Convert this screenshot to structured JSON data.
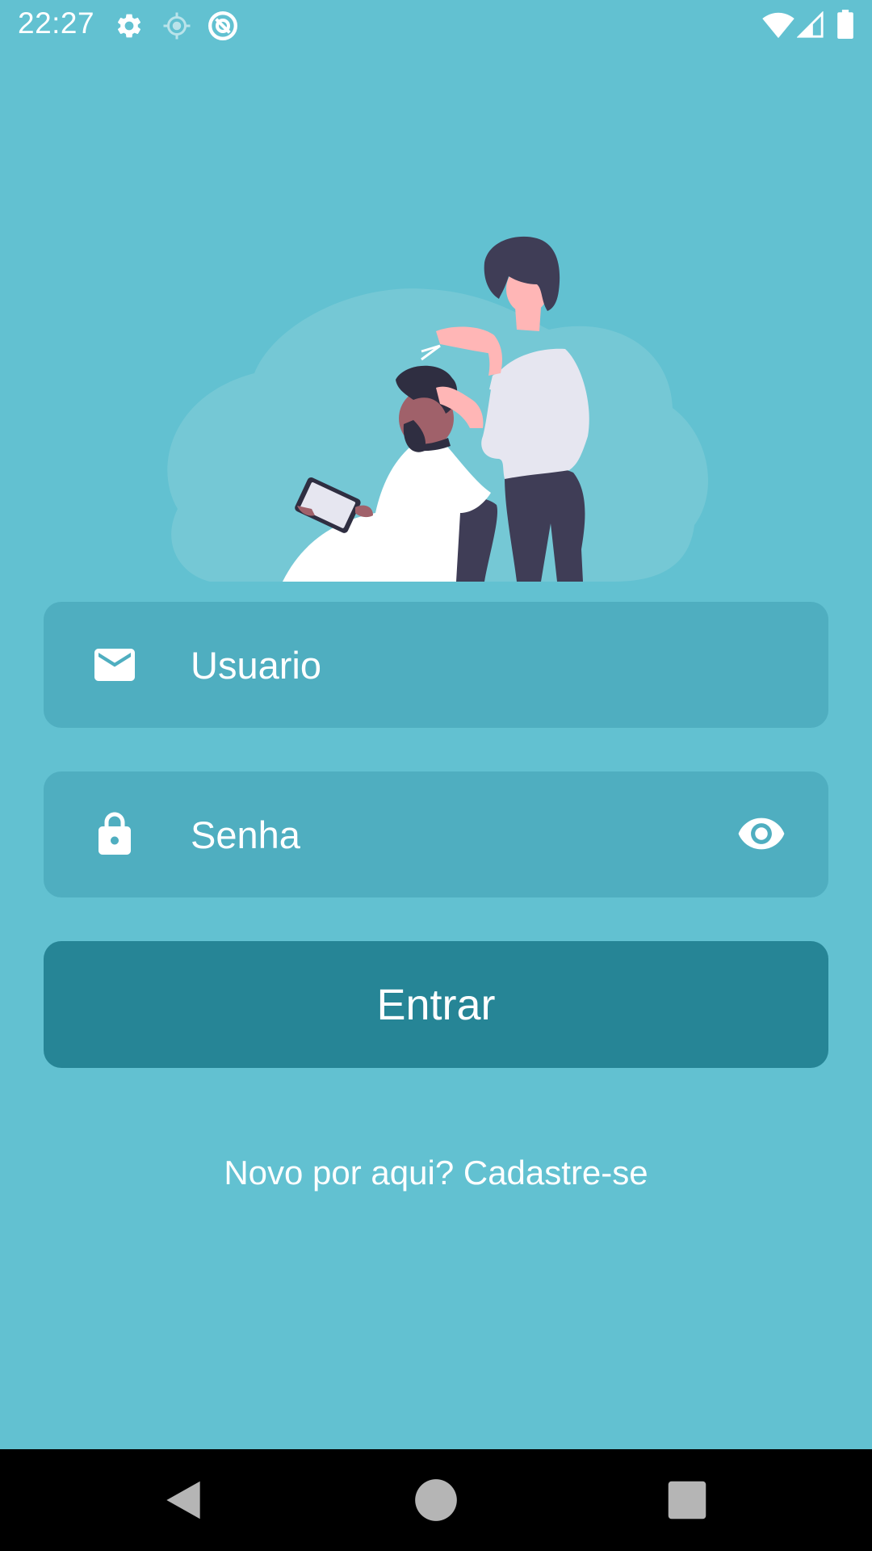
{
  "status_bar": {
    "time": "22:27",
    "icons_left": [
      "settings-icon",
      "location-icon",
      "sync-icon"
    ],
    "icons_right": [
      "wifi-icon",
      "signal-icon",
      "battery-icon"
    ]
  },
  "illustration": {
    "description_icon": "barber-illustration"
  },
  "login_form": {
    "username": {
      "placeholder": "Usuario",
      "value": "",
      "icon": "email-icon"
    },
    "password": {
      "placeholder": "Senha",
      "value": "",
      "icon": "lock-icon",
      "toggle_icon": "eye-icon"
    },
    "submit_label": "Entrar",
    "signup_text": "Novo por aqui? Cadastre-se"
  },
  "nav_bar": {
    "buttons": [
      "back-icon",
      "home-icon",
      "recents-icon"
    ]
  },
  "colors": {
    "background": "#62c1d1",
    "field_background": "#4faec0",
    "button_background": "#268596",
    "text": "#ffffff"
  }
}
